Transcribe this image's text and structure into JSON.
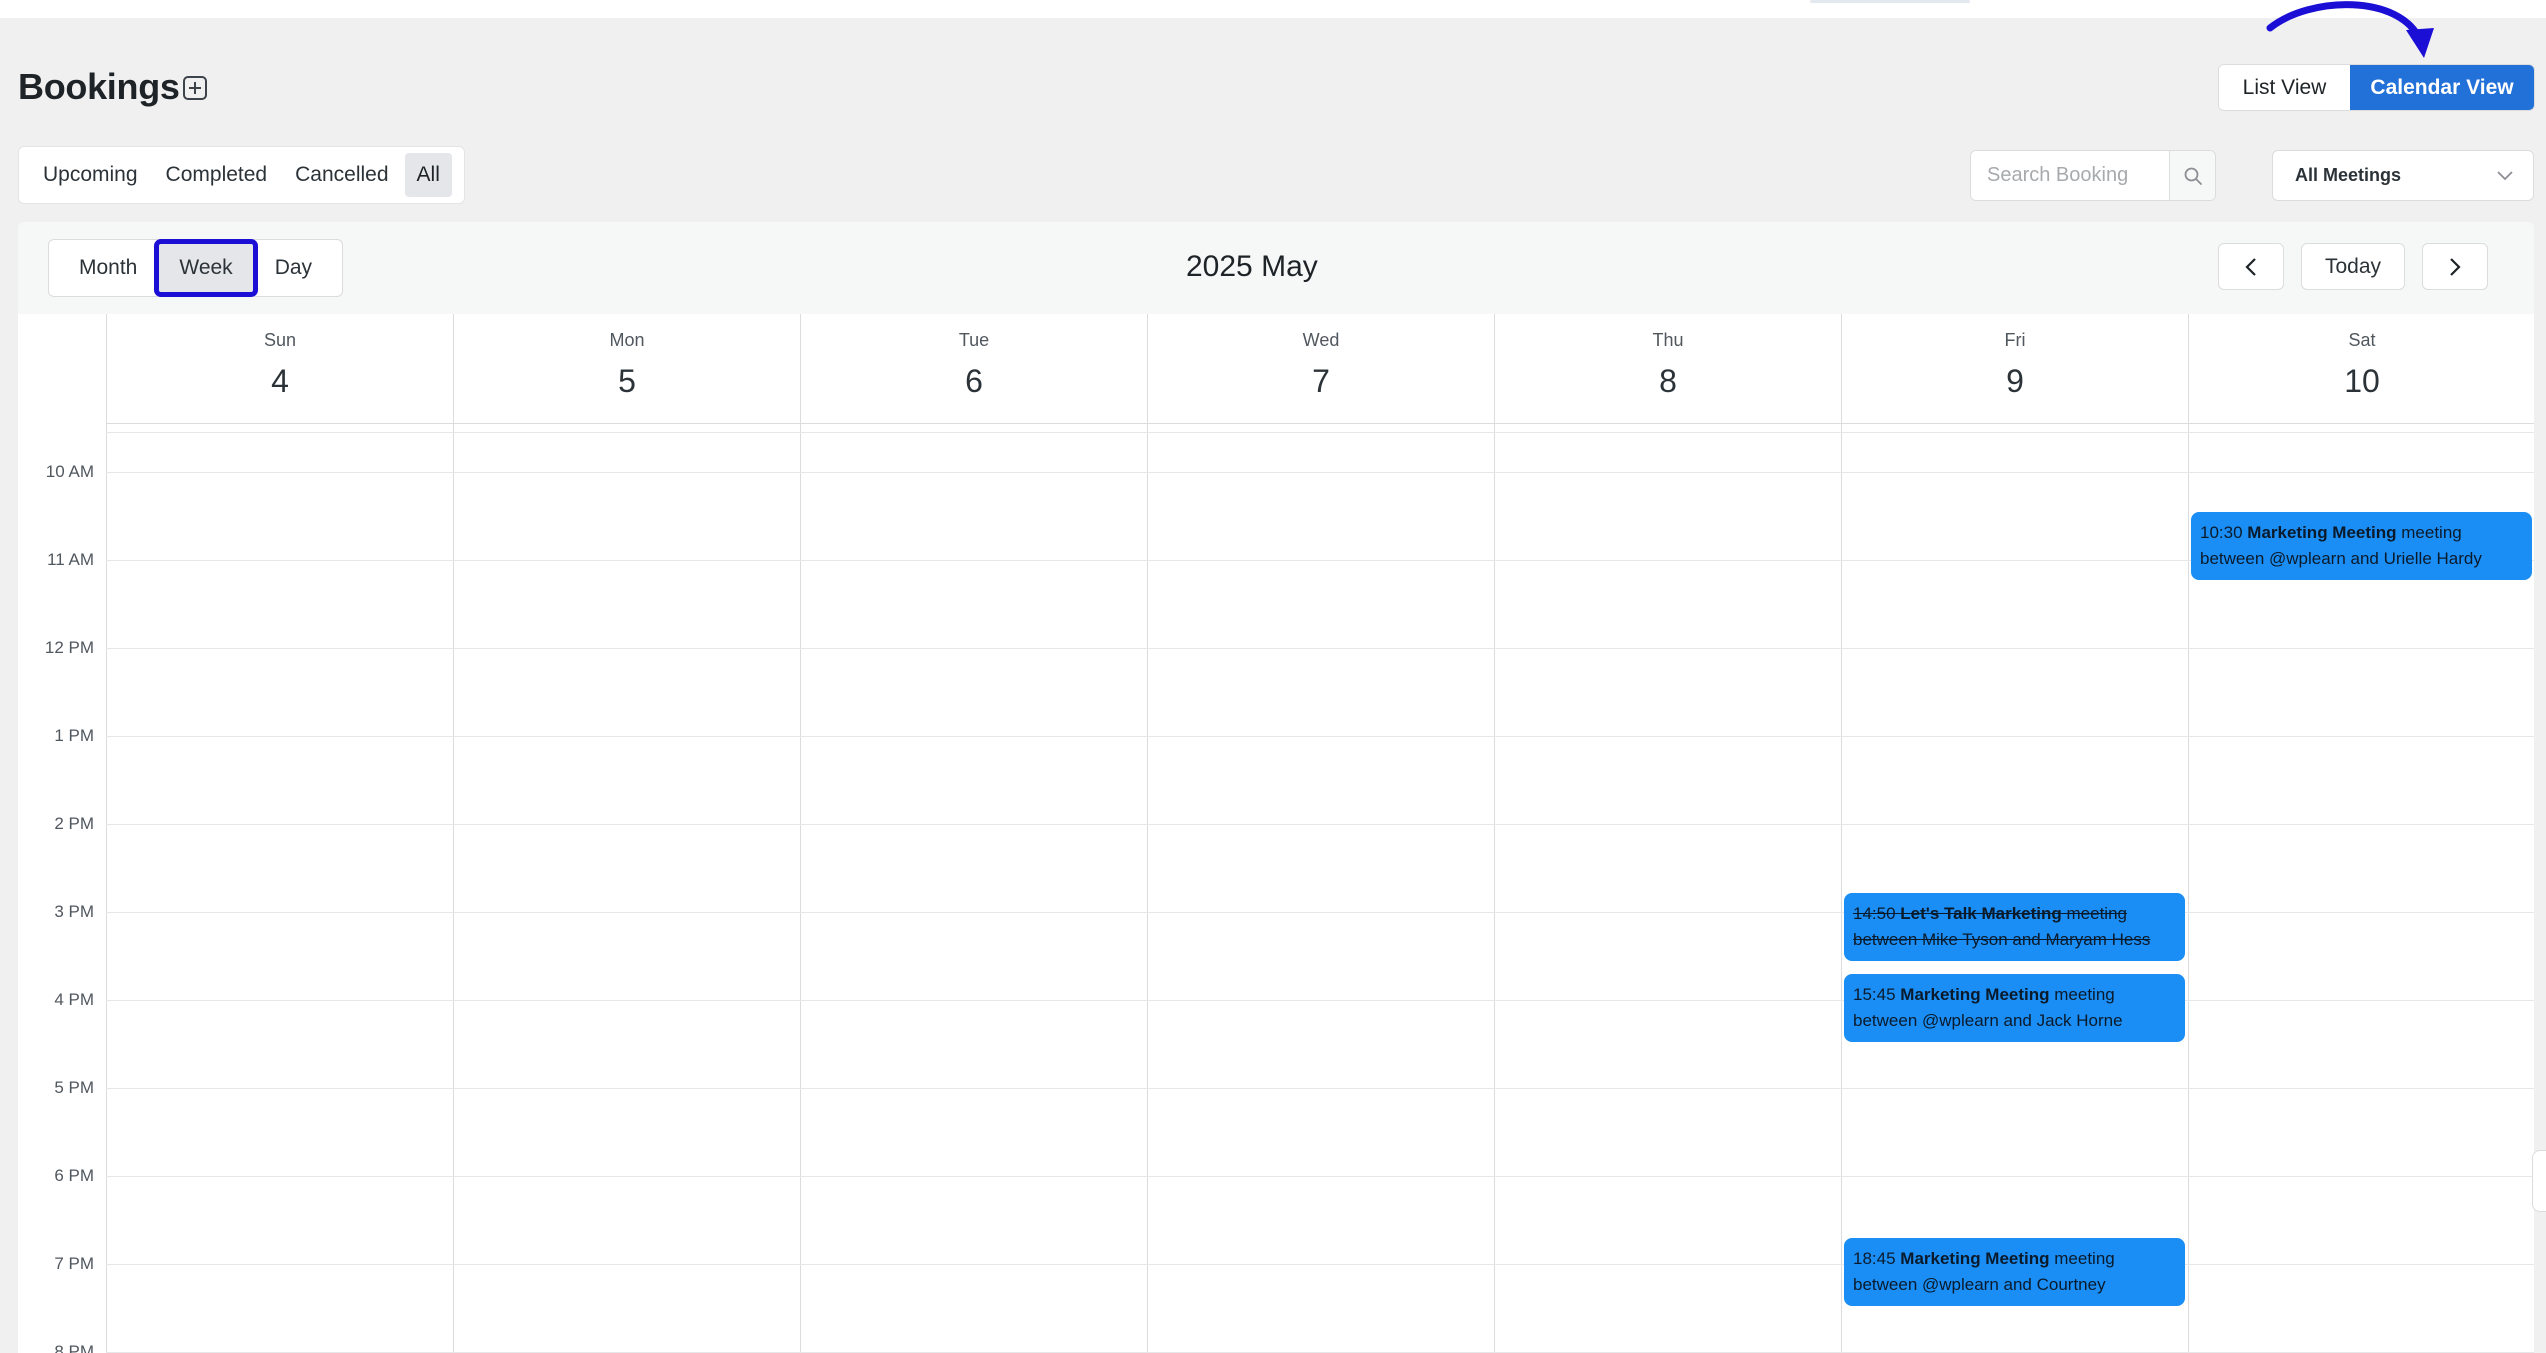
{
  "header": {
    "title": "Bookings",
    "view_toggle": {
      "list_label": "List View",
      "calendar_label": "Calendar View",
      "active": "Calendar View"
    }
  },
  "status_tabs": [
    {
      "label": "Upcoming",
      "active": false
    },
    {
      "label": "Completed",
      "active": false
    },
    {
      "label": "Cancelled",
      "active": false
    },
    {
      "label": "All",
      "active": true
    }
  ],
  "search": {
    "placeholder": "Search Booking",
    "value": ""
  },
  "meeting_filter": {
    "selected": "All Meetings"
  },
  "calendar": {
    "range_toggle": [
      {
        "label": "Month",
        "active": false
      },
      {
        "label": "Week",
        "active": true
      },
      {
        "label": "Day",
        "active": false
      }
    ],
    "period_label": "2025 May",
    "today_label": "Today",
    "days": [
      {
        "name": "Sun",
        "num": "4"
      },
      {
        "name": "Mon",
        "num": "5"
      },
      {
        "name": "Tue",
        "num": "6"
      },
      {
        "name": "Wed",
        "num": "7"
      },
      {
        "name": "Thu",
        "num": "8"
      },
      {
        "name": "Fri",
        "num": "9"
      },
      {
        "name": "Sat",
        "num": "10"
      }
    ],
    "hours": [
      "10 AM",
      "11 AM",
      "12 PM",
      "1 PM",
      "2 PM",
      "3 PM",
      "4 PM",
      "5 PM",
      "6 PM",
      "7 PM",
      "8 PM"
    ],
    "events": [
      {
        "day": "Sat",
        "time": "10:30",
        "title": "Marketing Meeting",
        "line1_suffix": "meeting",
        "line2": "between @wplearn and Urielle Hardy",
        "cancelled": false
      },
      {
        "day": "Fri",
        "time": "14:50",
        "title": "Let's Talk Marketing",
        "line1_suffix": "meeting",
        "line2": "between Mike Tyson and Maryam Hess",
        "cancelled": true
      },
      {
        "day": "Fri",
        "time": "15:45",
        "title": "Marketing Meeting",
        "line1_suffix": "meeting",
        "line2": "between @wplearn and Jack Horne",
        "cancelled": false
      },
      {
        "day": "Fri",
        "time": "18:45",
        "title": "Marketing Meeting",
        "line1_suffix": "meeting",
        "line2": "between @wplearn and Courtney",
        "cancelled": false
      }
    ]
  },
  "colors": {
    "accent": "#2271d8",
    "event": "#1a8ef5",
    "highlight": "#1b0fd6"
  }
}
